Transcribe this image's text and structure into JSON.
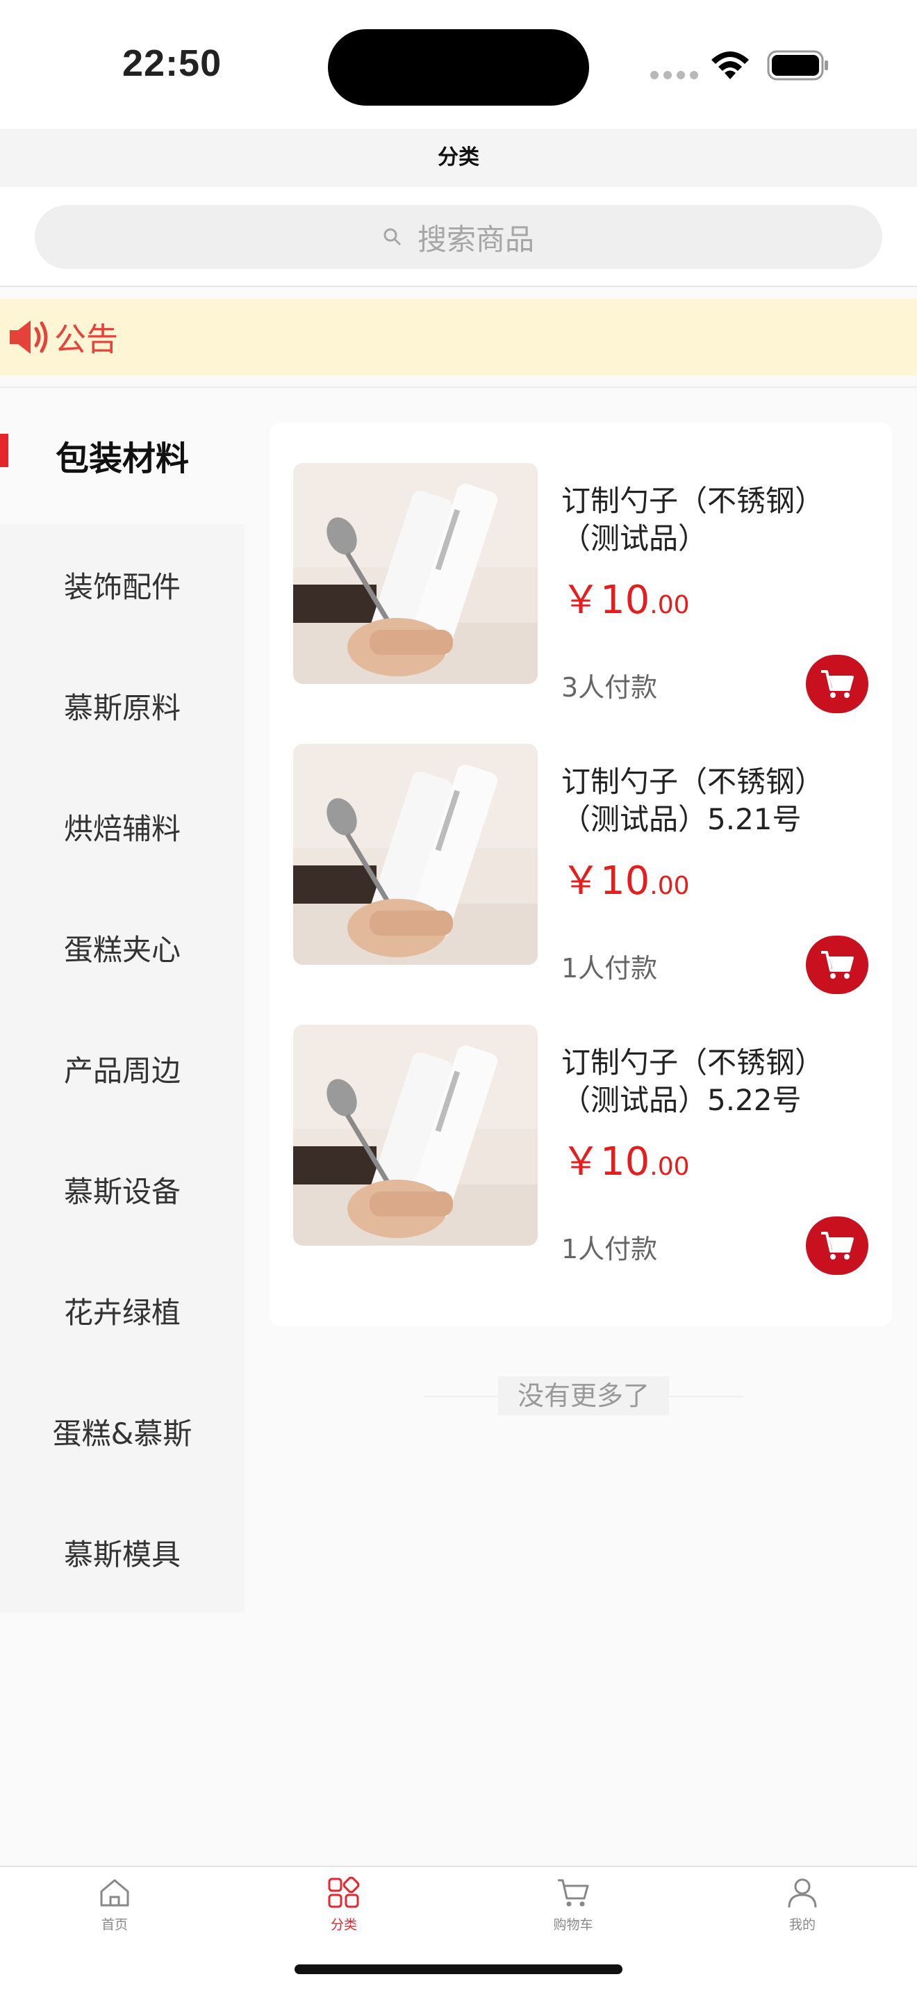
{
  "status_bar": {
    "time": "22:50"
  },
  "nav": {
    "title": "分类"
  },
  "search": {
    "placeholder": "搜索商品"
  },
  "notice": {
    "label": "公告"
  },
  "sidebar": {
    "items": [
      {
        "label": "包装材料",
        "active": true
      },
      {
        "label": "装饰配件"
      },
      {
        "label": "慕斯原料"
      },
      {
        "label": "烘焙辅料"
      },
      {
        "label": "蛋糕夹心"
      },
      {
        "label": "产品周边"
      },
      {
        "label": "慕斯设备"
      },
      {
        "label": "花卉绿植"
      },
      {
        "label": "蛋糕&慕斯"
      },
      {
        "label": "慕斯模具"
      }
    ]
  },
  "products": [
    {
      "title": "订制勺子（不锈钢）（测试品）",
      "currency": "￥",
      "price_int": "10",
      "price_dec": ".00",
      "sold": "3人付款"
    },
    {
      "title": "订制勺子（不锈钢）（测试品）5.21号",
      "currency": "￥",
      "price_int": "10",
      "price_dec": ".00",
      "sold": "1人付款"
    },
    {
      "title": "订制勺子（不锈钢）（测试品）5.22号",
      "currency": "￥",
      "price_int": "10",
      "price_dec": ".00",
      "sold": "1人付款"
    }
  ],
  "list_end": {
    "text": "没有更多了"
  },
  "tabbar": {
    "tabs": [
      {
        "label": "首页",
        "icon": "home-icon"
      },
      {
        "label": "分类",
        "icon": "grid-icon",
        "active": true
      },
      {
        "label": "购物车",
        "icon": "cart-icon"
      },
      {
        "label": "我的",
        "icon": "user-icon"
      }
    ]
  },
  "colors": {
    "accent": "#e5262c",
    "price": "#e51d1d",
    "cart_button": "#c8101e",
    "notice_bg": "#fdf5d4"
  }
}
